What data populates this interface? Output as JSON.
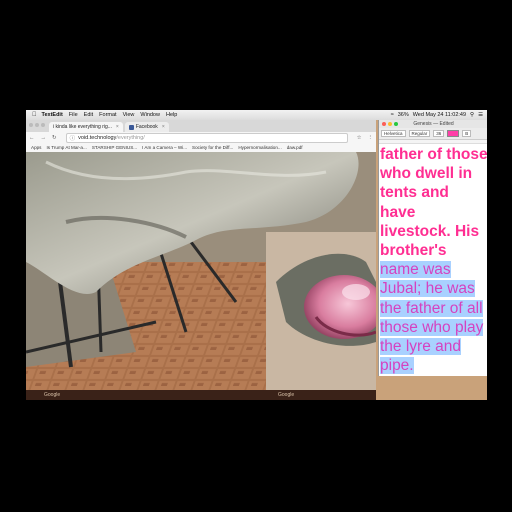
{
  "menubar": {
    "apple": "",
    "items": [
      "TextEdit",
      "File",
      "Edit",
      "Format",
      "View",
      "Window",
      "Help"
    ],
    "status": [
      "36%",
      "Wed May 24 11:02:49"
    ]
  },
  "browser": {
    "tabs": [
      {
        "label": "i kinda like everything rig..."
      },
      {
        "label": "Facebook"
      }
    ],
    "url_host": "void.technology",
    "url_path": "/everything/",
    "bookmarks": [
      "Apps",
      "Is Trump At Mar-a...",
      "STARSHIP GENIUS...",
      "I Am a Camera – Wi...",
      "Society for the Diff...",
      "Hypernormalisation...",
      "daw.pdf"
    ],
    "footer": [
      "Google",
      "Google"
    ]
  },
  "textedit": {
    "title": "Genesis — Edited",
    "toolbar": [
      "Helvetica",
      "Regular",
      "36",
      "B",
      "I",
      "U"
    ],
    "text_plain": "father of those who dwell in tents and have livestock. His brother's",
    "text_selected": "name was Jubal; he was the father of all those who play the lyre and pipe."
  },
  "colors": {
    "text_pink": "#ff2e92",
    "selection": "#a9d1ff"
  }
}
